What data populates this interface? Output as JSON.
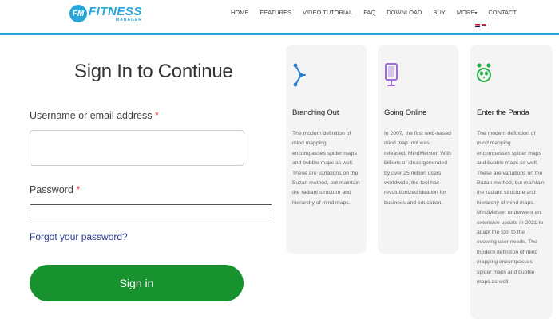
{
  "header": {
    "logo_badge": "FM",
    "logo_main": "FITNESS",
    "logo_sub": "MANAGER",
    "nav": [
      {
        "label": "HOME"
      },
      {
        "label": "FEATURES"
      },
      {
        "label": "VIDEO TUTORIAL"
      },
      {
        "label": "FAQ"
      },
      {
        "label": "DOWNLOAD"
      },
      {
        "label": "BUY"
      },
      {
        "label": "MORE"
      },
      {
        "label": "CONTACT"
      }
    ]
  },
  "signin": {
    "title": "Sign In to Continue",
    "username_label": "Username or email address",
    "password_label": "Password",
    "required_mark": "*",
    "forgot_label": "Forgot your password?",
    "button_label": "Sign in"
  },
  "cards": [
    {
      "icon": "network-icon",
      "title": "Branching Out",
      "text": "The modern definition of mind mapping encompasses spider maps and bubble maps as well. These are variations on the Buzan method, but maintain the radiant structure and hierarchy of mind maps."
    },
    {
      "icon": "monitor-icon",
      "title": "Going Online",
      "text": "In 2007, the first web-based mind map tool was released: MindMeister. With billions of ideas generated by over 25 million users worldwide, the tool has revolutionized ideation for business and education."
    },
    {
      "icon": "panda-icon",
      "title": "Enter the Panda",
      "text": "The modern definition of mind mapping encompasses spider maps and bubble maps as well. These are variations on the Buzan method, but maintain the radiant structure and hierarchy of mind maps. MindMeister underwent an extensive update in 2021 to adapt the tool to the evolving user needs. The modern definition of mind mapping encompasses spider maps and bubble maps as well."
    }
  ],
  "colors": {
    "brand": "#2aa5d8",
    "button": "#17922f",
    "link": "#2b3a8f",
    "required": "#d9363e",
    "icon_blue": "#2a7fd4",
    "icon_purple": "#a06ad8",
    "icon_green": "#2bb24c"
  }
}
